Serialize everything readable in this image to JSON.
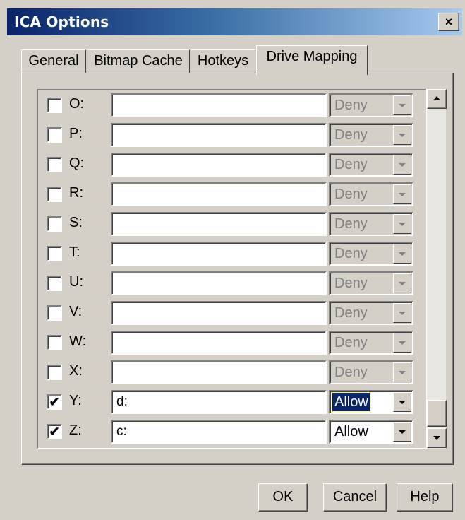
{
  "window": {
    "title": "ICA Options",
    "close_label": "×"
  },
  "tabs": [
    {
      "label": "General"
    },
    {
      "label": "Bitmap Cache"
    },
    {
      "label": "Hotkeys"
    },
    {
      "label": "Drive Mapping"
    }
  ],
  "active_tab": "Drive Mapping",
  "drives": [
    {
      "letter": "O:",
      "checked": false,
      "path": "",
      "access": "Deny",
      "enabled": false
    },
    {
      "letter": "P:",
      "checked": false,
      "path": "",
      "access": "Deny",
      "enabled": false
    },
    {
      "letter": "Q:",
      "checked": false,
      "path": "",
      "access": "Deny",
      "enabled": false
    },
    {
      "letter": "R:",
      "checked": false,
      "path": "",
      "access": "Deny",
      "enabled": false
    },
    {
      "letter": "S:",
      "checked": false,
      "path": "",
      "access": "Deny",
      "enabled": false
    },
    {
      "letter": "T:",
      "checked": false,
      "path": "",
      "access": "Deny",
      "enabled": false
    },
    {
      "letter": "U:",
      "checked": false,
      "path": "",
      "access": "Deny",
      "enabled": false
    },
    {
      "letter": "V:",
      "checked": false,
      "path": "",
      "access": "Deny",
      "enabled": false
    },
    {
      "letter": "W:",
      "checked": false,
      "path": "",
      "access": "Deny",
      "enabled": false
    },
    {
      "letter": "X:",
      "checked": false,
      "path": "",
      "access": "Deny",
      "enabled": false
    },
    {
      "letter": "Y:",
      "checked": true,
      "path": "d:",
      "access": "Allow",
      "enabled": true,
      "focused": true
    },
    {
      "letter": "Z:",
      "checked": true,
      "path": "c:",
      "access": "Allow",
      "enabled": true
    }
  ],
  "buttons": {
    "ok": "OK",
    "cancel": "Cancel",
    "help": "Help"
  },
  "colors": {
    "titlebar_start": "#0a246a",
    "titlebar_end": "#a6caf0",
    "face": "#d4d0c8"
  }
}
